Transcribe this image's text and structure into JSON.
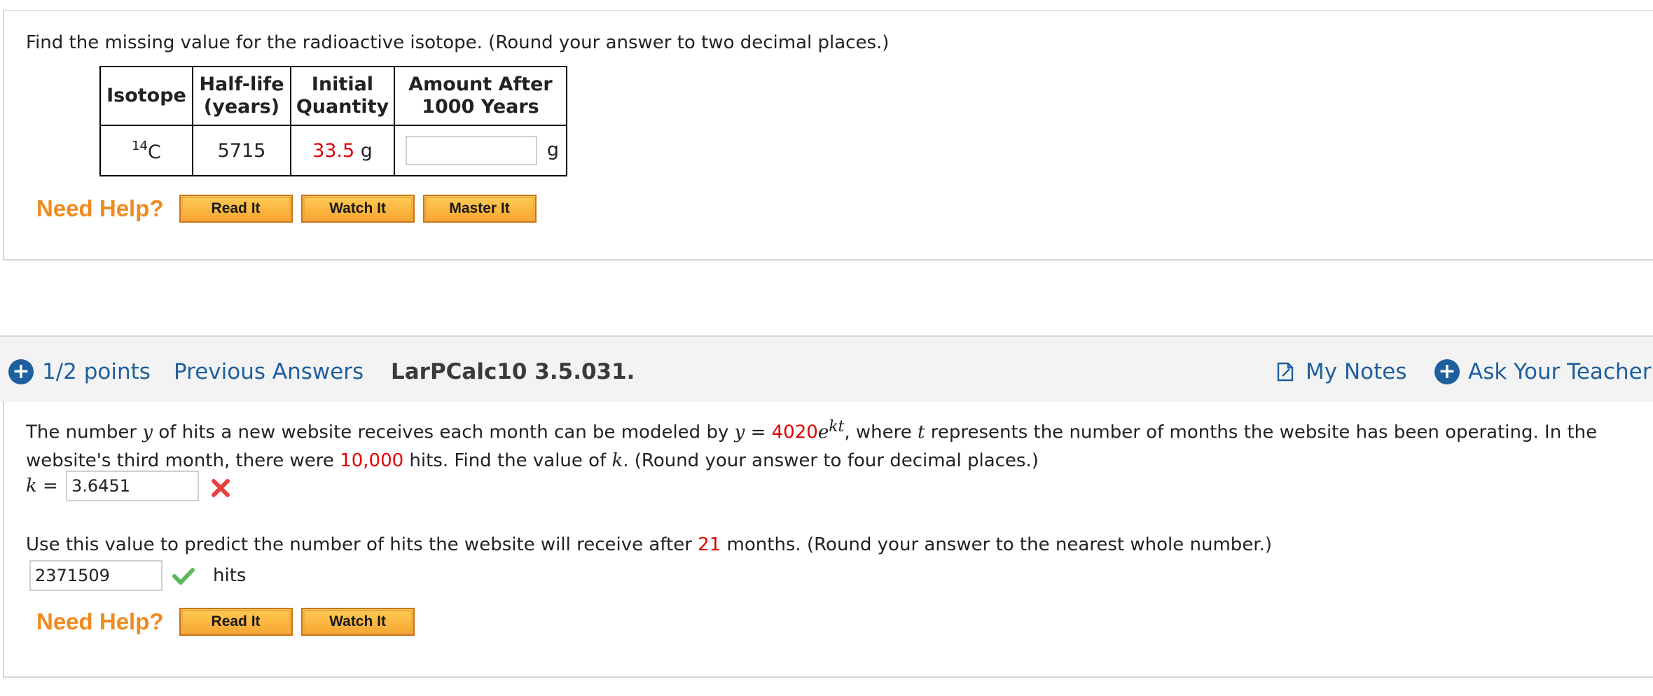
{
  "q1": {
    "instruction": "Find the missing value for the radioactive isotope. (Round your answer to two decimal places.)",
    "table": {
      "headers": [
        [
          "Isotope"
        ],
        [
          "Half-life",
          "(years)"
        ],
        [
          "Initial",
          "Quantity"
        ],
        [
          "Amount After",
          "1000 Years"
        ]
      ],
      "row": {
        "isotope_mass": "14",
        "isotope_symbol": "C",
        "half_life": "5715",
        "initial_value": "33.5",
        "initial_unit": "g",
        "answer_value": "",
        "answer_unit": "g"
      }
    },
    "help": {
      "label": "Need Help?",
      "buttons": [
        "Read It",
        "Watch It",
        "Master It"
      ]
    }
  },
  "q2_header": {
    "points": "1/2 points",
    "previous_answers": "Previous Answers",
    "problem_id": "LarPCalc10 3.5.031.",
    "my_notes": "My Notes",
    "ask_teacher": "Ask Your Teacher"
  },
  "q2": {
    "line1_a": "The number ",
    "var_y": "y",
    "line1_b": " of hits a new website receives each month can be modeled by  ",
    "eq_lhs": "y",
    "eq_equals": " = ",
    "eq_coef": "4020",
    "eq_base": "e",
    "eq_exp": "kt",
    "line1_c": ",  where ",
    "var_t": "t",
    "line1_d": " represents the number of months the website has been operating. In the",
    "line2_a": "website's third month, there were ",
    "line2_value": "10,000",
    "line2_b": " hits. Find the value of ",
    "var_k": "k",
    "line2_c": ". (Round your answer to four decimal places.)",
    "k_label_var": "k",
    "k_label_eq": " = ",
    "k_answer": "3.6451",
    "k_status": "incorrect",
    "part2_a": "Use this value to predict the number of hits the website will receive after ",
    "part2_value": "21",
    "part2_b": " months. (Round your answer to the nearest whole number.)",
    "hits_answer": "2371509",
    "hits_status": "correct",
    "hits_unit": "hits",
    "help": {
      "label": "Need Help?",
      "buttons": [
        "Read It",
        "Watch It"
      ]
    }
  },
  "colors": {
    "link_blue": "#1e5f9e",
    "highlight_red": "#e00000",
    "help_orange": "#f08a1e",
    "button_orange": "#f7a531",
    "correct_green": "#5cb85c",
    "incorrect_red": "#e8403a"
  }
}
